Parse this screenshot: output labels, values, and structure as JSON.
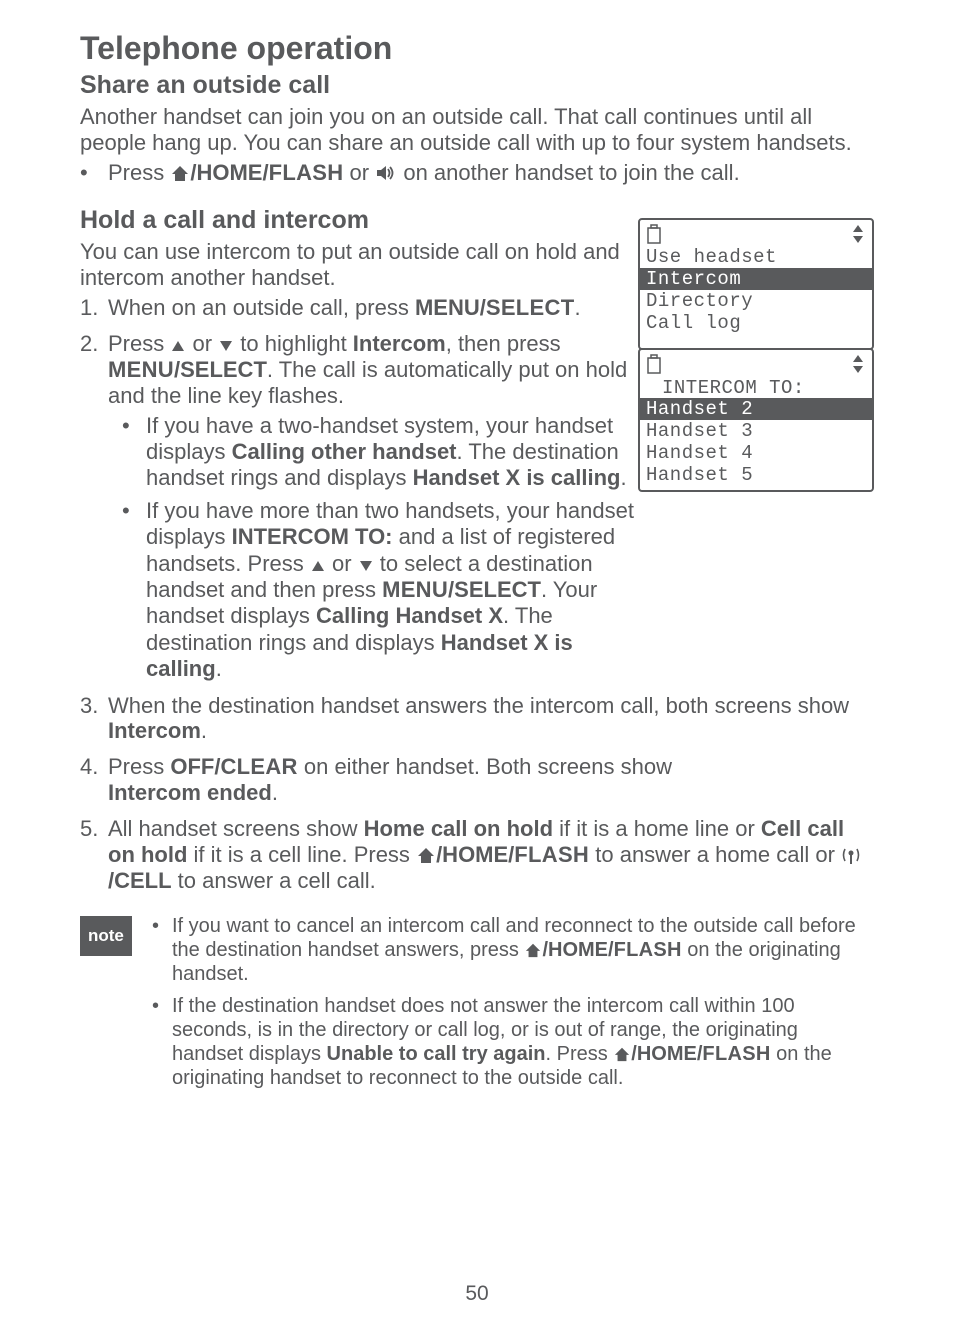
{
  "page_number": "50",
  "h1": "Telephone operation",
  "share": {
    "heading": "Share an outside call",
    "body": "Another handset can join you on an outside call. That call continues until all people hang up. You can share an outside call with up to four system handsets.",
    "bullet_pre": "Press ",
    "bullet_key_a": "/HOME/",
    "bullet_key_a_sc": "FLASH",
    "bullet_mid": " or ",
    "bullet_post": " on another handset to join the call."
  },
  "hold": {
    "heading": "Hold a call and intercom",
    "intro": "You can use intercom to put an outside call on hold and intercom another handset.",
    "steps_a": {
      "s1_pre": "When on an outside call, press ",
      "s1_key": "MENU/",
      "s1_key_sc": "SELECT",
      "s1_post": ".",
      "s2_pre": "Press ",
      "s2_mid1": " or ",
      "s2_mid2": " to highlight ",
      "s2_intercom": "Intercom",
      "s2_mid3": ", then press ",
      "s2_key_sc": "MENU",
      "s2_key": "/SELECT",
      "s2_post": ". The call is automatically put on hold and the line key flashes.",
      "sub1_a": "If you have a two-handset system, your handset displays ",
      "sub1_b": "Calling other handset",
      "sub1_c": ". The destination handset rings and displays ",
      "sub1_d": "Handset X is calling",
      "sub1_e": ".",
      "sub2_a": "If you have more than two handsets, your handset displays ",
      "sub2_b": "INTERCOM TO:",
      "sub2_c": " and a list of registered handsets. Press ",
      "sub2_d": " or ",
      "sub2_e": " to select a destination handset and then press ",
      "sub2_key_sc": "MENU",
      "sub2_key": "/SELECT",
      "sub2_f": ". Your handset displays ",
      "sub2_g": "Calling Handset X",
      "sub2_h": ". The destination rings and displays ",
      "sub2_i": "Handset X is calling",
      "sub2_j": "."
    },
    "steps_b": {
      "s3_a": "When the destination handset answers the intercom call, both screens show ",
      "s3_b": "Intercom",
      "s3_c": ".",
      "s4_a": "Press ",
      "s4_b": "OFF/",
      "s4_b_sc": "CLEAR",
      "s4_c": " on either handset. Both screens show ",
      "s4_d": "Intercom ended",
      "s4_e": ".",
      "s5_a": "All handset screens show ",
      "s5_b": "Home call on hold",
      "s5_c": " if it is a home line or ",
      "s5_d": "Cell call on hold",
      "s5_e": " if it is a cell line. Press ",
      "s5_key1": "/HOME/",
      "s5_key1_sc": "FLASH",
      "s5_f": " to answer a home call or ",
      "s5_key2": "/CELL",
      "s5_g": " to answer a cell call."
    }
  },
  "lcd1": {
    "r1": "Use headset",
    "r2": "Intercom",
    "r3": "Directory",
    "r4": "Call log"
  },
  "lcd2": {
    "title": "INTERCOM TO:",
    "r1": "Handset 2",
    "r2": "Handset 3",
    "r3": "Handset 4",
    "r4": "Handset 5"
  },
  "note": {
    "label": "note",
    "n1_a": "If you want to cancel an intercom call and reconnect to the outside call before the destination handset answers, press ",
    "n1_key": "/HOME/",
    "n1_key_sc": "FLASH",
    "n1_b": " on the originating handset.",
    "n2_a": "If the destination handset does not answer the intercom call within 100 seconds, is in the directory or call log, or is out of range, the originating handset displays ",
    "n2_b": "Unable to call try again",
    "n2_c": ". Press ",
    "n2_key": "/HOME/",
    "n2_key_sc": "FLASH",
    "n2_d": " on the originating handset to reconnect to the outside call."
  }
}
